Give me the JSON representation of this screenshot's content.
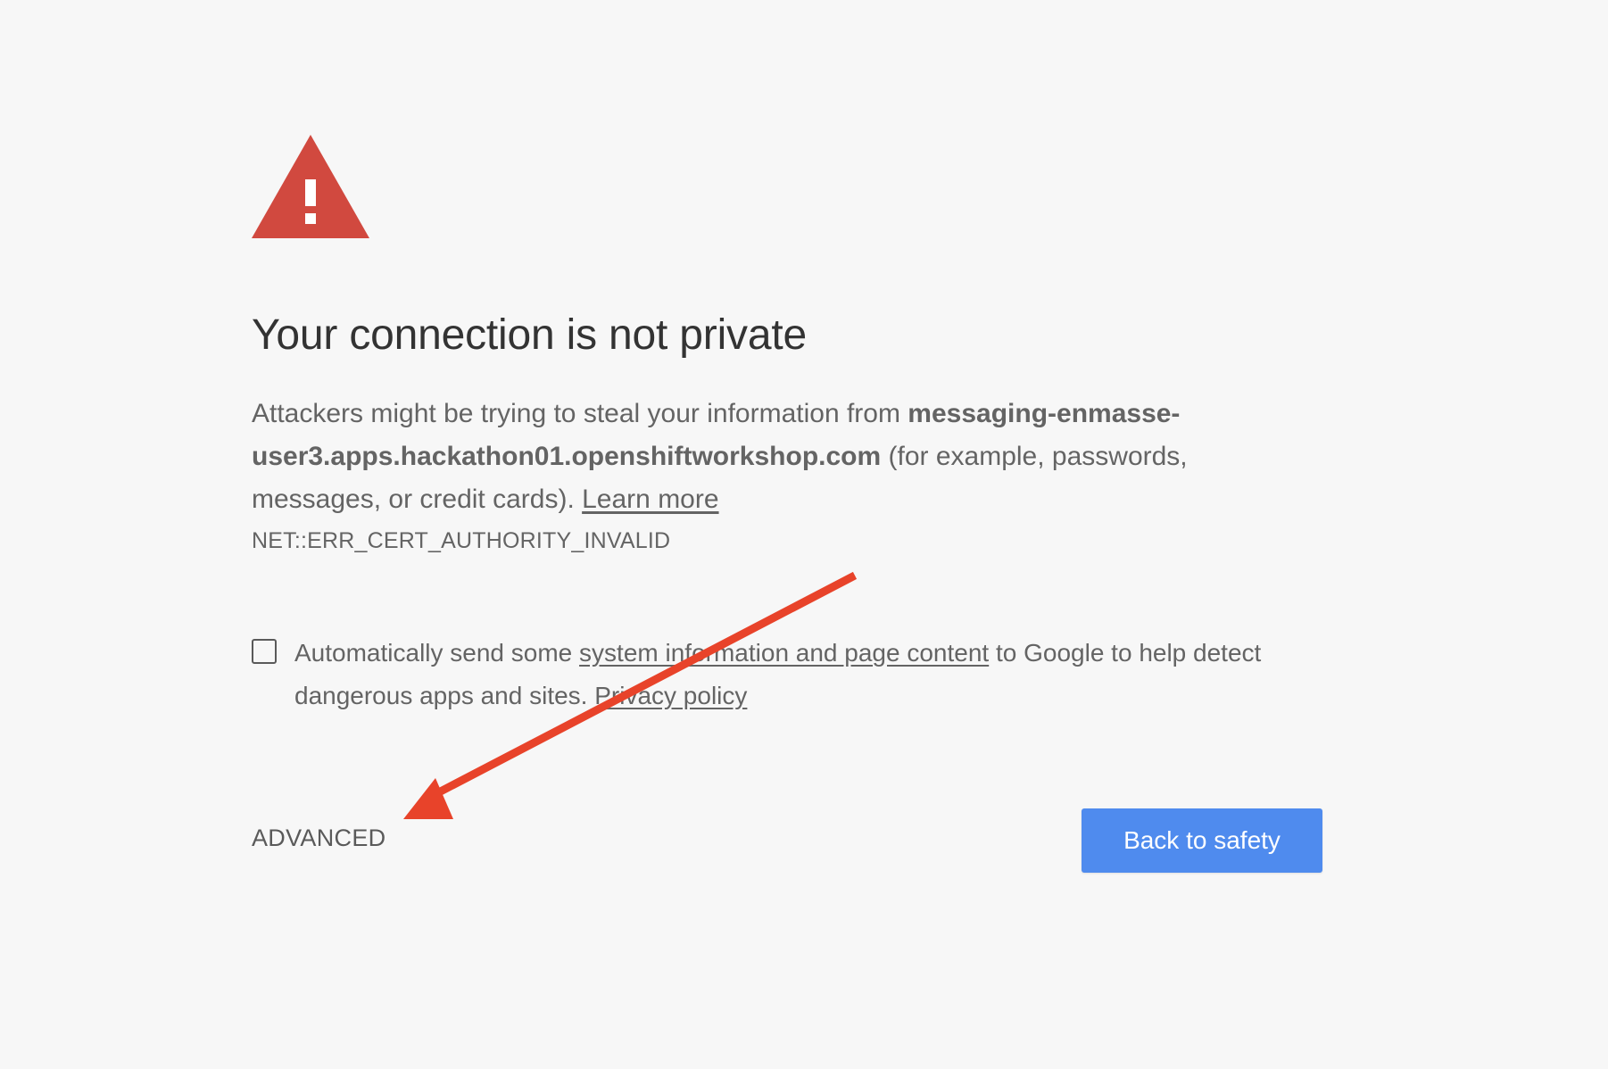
{
  "page": {
    "title": "Your connection is not private"
  },
  "message": {
    "prefix": "Attackers might be trying to steal your information from ",
    "hostname": "messaging-enmasse-user3.apps.hackathon01.openshiftworkshop.com",
    "suffix": " (for example, passwords, messages, or credit cards). ",
    "learn_more": "Learn more"
  },
  "error_code": "NET::ERR_CERT_AUTHORITY_INVALID",
  "optin": {
    "checked": false,
    "text_before": "Automatically send some ",
    "link_text": "system information and page content",
    "text_after": " to Google to help detect dangerous apps and sites. ",
    "privacy_link": "Privacy policy"
  },
  "buttons": {
    "advanced": "ADVANCED",
    "back_to_safety": "Back to safety"
  },
  "colors": {
    "background": "#f7f7f7",
    "warning_red": "#d1493f",
    "primary_blue": "#4f8bee",
    "annotation_arrow": "#e8432a",
    "text": "#646464",
    "heading": "#333333"
  },
  "icons": {
    "warning": "warning-triangle-icon",
    "annotation": "red-arrow-annotation"
  }
}
